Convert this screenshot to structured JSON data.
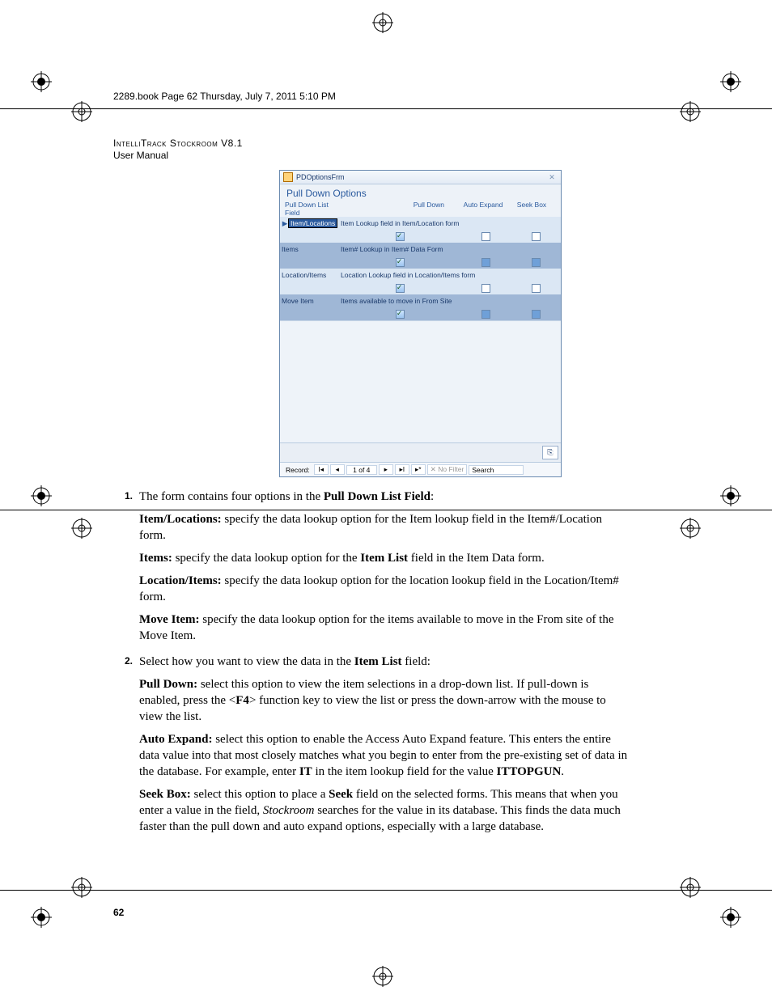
{
  "bookline": "2289.book  Page 62  Thursday, July 7, 2011  5:10 PM",
  "header": {
    "l1": "IntelliTrack Stockroom V8.1",
    "l2": "User Manual"
  },
  "shot": {
    "win_title": "PDOptionsFrm",
    "heading": "Pull Down Options",
    "col1": "Pull Down List Field",
    "col2": "Pull Down",
    "col3": "Auto Expand",
    "col4": "Seek Box",
    "rows": [
      {
        "name": "Item/Locations",
        "desc": "Item Lookup field in Item/Location form",
        "pd": true,
        "ae": false,
        "sb": false,
        "sel": true,
        "band": "A"
      },
      {
        "name": "Items",
        "desc": "Item# Lookup in Item# Data Form",
        "pd": true,
        "ae": "mid",
        "sb": "mid",
        "band": "B"
      },
      {
        "name": "Location/Items",
        "desc": "Location Lookup field in Location/Items form",
        "pd": true,
        "ae": false,
        "sb": false,
        "band": "A"
      },
      {
        "name": "Move Item",
        "desc": "Items available to move in From Site",
        "pd": true,
        "ae": "mid",
        "sb": "mid",
        "band": "B"
      }
    ],
    "rec_label": "Record:",
    "rec_pos": "1 of 4",
    "nofilter": "No Filter",
    "search": "Search"
  },
  "t": {
    "p1a": "The form contains four options in the ",
    "p1b": "Pull Down List Field",
    "p1c": ":",
    "il_a": "Item/Locations:",
    "il_b": " specify the data lookup option for the Item lookup field in the Item#/Location form.",
    "it_a": "Items:",
    "it_b": " specify the data lookup option for the ",
    "it_c": "Item List",
    "it_d": " field in the Item Data form.",
    "li_a": "Location/Items:",
    "li_b": " specify the data lookup option for the location lookup field in the Location/Item# form.",
    "mi_a": "Move Item:",
    "mi_b": " specify the data lookup option for the items available to move in the From site of the Move Item.",
    "p2a": "Select how you want to view the data in the ",
    "p2b": "Item List",
    "p2c": " field:",
    "pd_a": "Pull Down:",
    "pd_b": " select this option to view the item selections in a drop-down list. If pull-down is enabled, press the <",
    "pd_c": "F4",
    "pd_d": "> function key to view the list or press the down-arrow with the mouse to view the list.",
    "ae_a": "Auto Expand:",
    "ae_b": " select this option to enable the Access Auto Expand feature. This enters the entire data value into that most closely matches what you begin to enter from the pre-existing set of data in the database. For example, enter ",
    "ae_c": "IT",
    "ae_d": " in the item lookup field for the value ",
    "ae_e": "ITTOPGUN",
    "ae_f": ".",
    "sb_a": "Seek Box:",
    "sb_b": " select this option to place a ",
    "sb_c": "Seek",
    "sb_d": " field on the selected forms. This means that when you enter a value in the field, ",
    "sb_e": "Stockroom",
    "sb_f": " searches for the value in its database. This finds the data much faster than the pull down and auto expand options, especially with a large database."
  },
  "n1": "1.",
  "n2": "2.",
  "page_number": "62"
}
